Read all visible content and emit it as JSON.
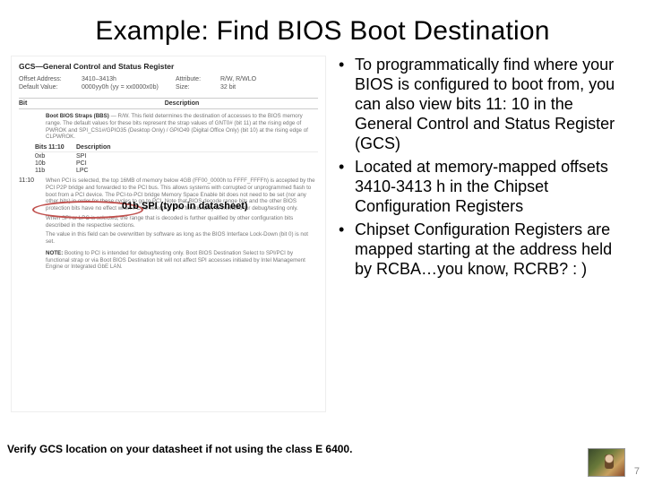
{
  "title": "Example: Find BIOS Boot Destination",
  "datasheet": {
    "heading": "GCS—General Control and Status Register",
    "offset_label": "Offset Address:",
    "offset_value": "3410–3413h",
    "attr_label": "Attribute:",
    "attr_value": "R/W, R/WLO",
    "default_label": "Default Value:",
    "default_value": "0000yy0h (yy = xx0000x0b)",
    "size_label": "Size:",
    "size_value": "32 bit",
    "col_bit": "Bit",
    "col_desc": "Description",
    "bbs_title": "Boot BIOS Straps (BBS)",
    "bbs_rw": "— R/W.",
    "bbs_text1": "This field determines the destination of accesses to the BIOS memory range. The default values for these bits represent the strap values of GNT0# (bit 11) at the rising edge of PWROK and SPI_CS1#/GPIO35 (Desktop Only) / GPIO49 (Digital Office Only) (bit 10) at the rising edge of CLPWROK.",
    "sub_h1": "Bits 11:10",
    "sub_h2": "Description",
    "sub_r0a": "0xb",
    "sub_r0b": "SPI",
    "sub_r1a": "10b",
    "sub_r1b": "PCI",
    "sub_r2a": "11b",
    "sub_r2b": "LPC",
    "bits_field": "11:10",
    "bbs_text2": "When PCI is selected, the top 16MB of memory below 4GB (FF00_0000h to FFFF_FFFFh) is accepted by the PCI P2P bridge and forwarded to the PCI bus. This allows systems with corrupted or unprogrammed flash to boot from a PCI device. The PCI-to-PCI bridge Memory Space Enable bit does not need to be set (nor any other bits) in order for these cycles to go to PCI. Note that BIOS decode range bits and the other BIOS protection bits have no effect when PCI is selected. This functionality is intended for debug/testing only.",
    "bbs_text3": "When SPI or LPC is selected, the range that is decoded is further qualified by other configuration bits described in the respective sections.",
    "bbs_text4": "The value in this field can be overwritten by software as long as the BIOS Interface Lock-Down (bit 0) is not set.",
    "note_label": "NOTE:",
    "note_text": "Booting to PCI is intended for debug/testing only. Boot BIOS Destination Select to SPI/PCI by functional strap or via Boot BIOS Destination bit will not affect SPI accesses initiated by Intel Management Engine or Integrated GbE LAN."
  },
  "callout": "01b SPI (typo in datasheet)",
  "bullets": {
    "b1": "To programmatically find where your BIOS is configured to boot from, you can also view bits 11: 10 in the General Control and Status Register (GCS)",
    "b2": "Located at memory-mapped offsets 3410-3413 h in the Chipset Configuration Registers",
    "b3": "Chipset Configuration Registers are mapped starting at the address held by RCBA…you know, RCRB? : )"
  },
  "footnote": "Verify GCS location on your datasheet if not using the class E 6400.",
  "page": "7"
}
